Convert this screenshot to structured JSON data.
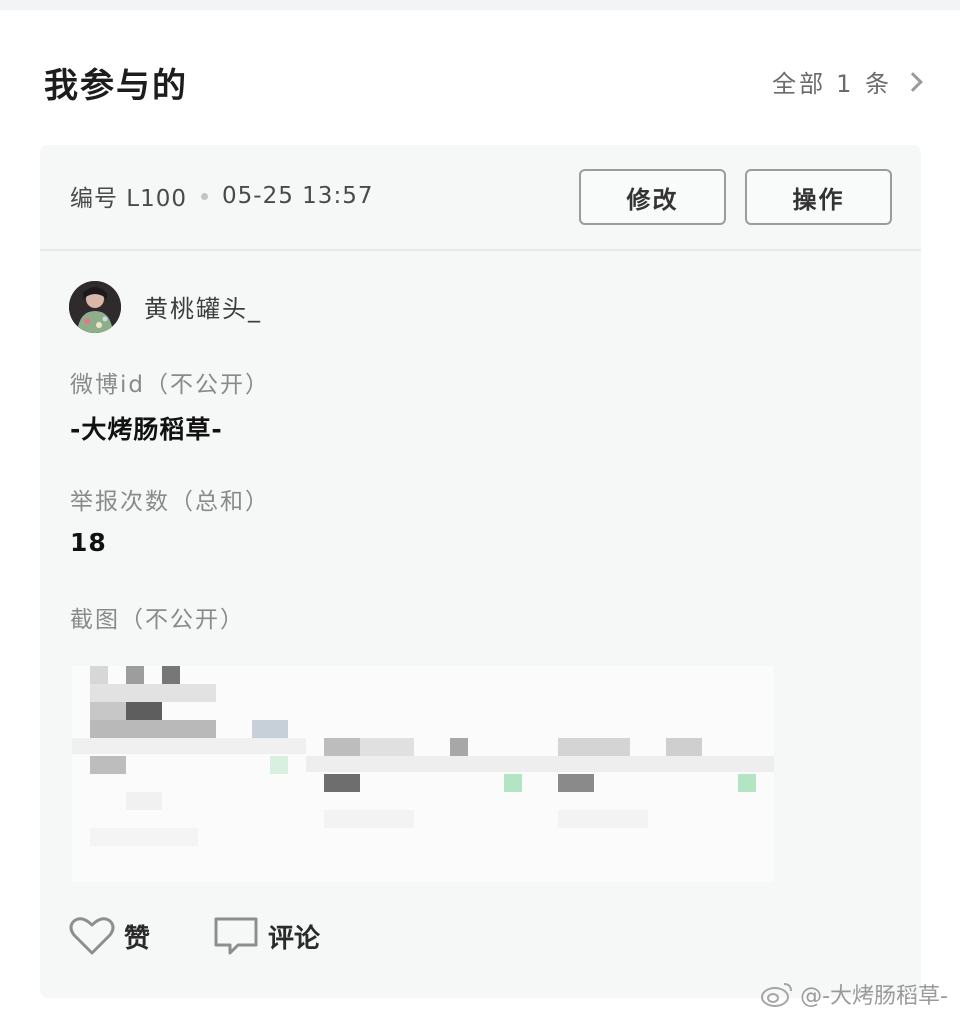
{
  "section": {
    "title": "我参与的",
    "all_label": "全部",
    "count_label": "1 条"
  },
  "card": {
    "number": "编号 L100",
    "time": "05-25 13:57",
    "edit_label": "修改",
    "op_label": "操作",
    "username": "黄桃罐头_",
    "weibo_id_label": "微博id（不公开）",
    "weibo_id_value": "-大烤肠稻草-",
    "report_label": "举报次数（总和）",
    "report_value": "18",
    "screenshot_label": "截图（不公开）",
    "like_label": "赞",
    "comment_label": "评论"
  },
  "watermark": "@-大烤肠稻草-",
  "icons": {
    "chevron": "chevron-right-icon",
    "like": "heart-icon",
    "comment": "comment-icon",
    "weibo": "weibo-logo-icon"
  }
}
